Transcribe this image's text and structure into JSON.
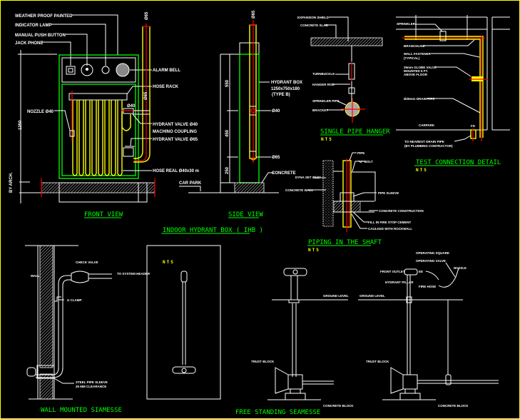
{
  "drawing": {
    "colors": {
      "background": "#000000",
      "border": "#ffff00",
      "titles": "#00ff00",
      "nts": "#ffff00",
      "lines": "#ffffff",
      "pipe": "#ffff00",
      "centerline": "#ff0000",
      "box": "#00ff00"
    },
    "front_view": {
      "title": "FRONT VIEW",
      "labels": {
        "weather_proof": "WEATHER PROOF PAINTED",
        "indicator_lamp": "INDICATOR LAMP",
        "manual_push": "MANUAL PUSH BUTTON",
        "jack_phone": "JACK PHONE",
        "alarm_bell": "ALARM BELL",
        "hose_rack": "HOSE RACK",
        "nozzle": "NOZZLE Ø40",
        "hydrant_valve_40": "HYDRANT VALVE Ø40",
        "machino": "MACHINO COUPLING",
        "hydrant_valve_65": "HYDRANT VALVE Ø65",
        "hose_reel": "HOSE REAL Ø40x30 m",
        "dim_total": "1250",
        "dim_arch": "BY ARCH.",
        "d65_top": "Ø65",
        "d65_side": "Ø65",
        "d40": "Ø40"
      }
    },
    "side_view": {
      "title": "SIDE VIEW",
      "labels": {
        "box": "HYDRANT BOX",
        "box_size": "1250x750x180",
        "box_type": "(TYPE B)",
        "d40": "Ø40",
        "d65": "Ø65",
        "d65_top": "Ø65",
        "concrete": "CONCRETE",
        "car_park": "CAR PARK",
        "dim_top": "550",
        "dim_mid": "450",
        "dim_bot": "250"
      }
    },
    "ihb_title": "INDOOR HYDRANT BOX ( IHB )",
    "single_pipe_hanger": {
      "title": "SINGLE PIPE HANGER",
      "nts": "NTS",
      "labels": {
        "expansion": "EXPANSION SHIELD",
        "slab": "CONCRETE SLAB",
        "turnbuckle": "TURNBUCKLE",
        "hanger_rod": "HANGER ROD",
        "sprinkler_pipe": "SPRINKLER PIPE",
        "bracket": "BRACKET"
      }
    },
    "test_connection": {
      "title": "TEST CONNECTION DETAIL",
      "nts": "NTS",
      "labels": {
        "sprinkler": "SPRINKLER",
        "branchline": "BRANCHLINE",
        "wall_fastener": "WALL FASTENER",
        "typical": "(TYPICAL)",
        "globe1": "25mm GLOBE VALVE",
        "globe2": "MOUNTED 5 FT.",
        "globe3": "ABOVE FLOOR",
        "drain": "Ø25mm DRAIN PIPE",
        "carpark": "CARPARK",
        "fd": "FD",
        "to_drain1": "TO NEAREST DRAIN PIPE",
        "to_drain2": "(BY PLUMBING CONTRACTOR)"
      }
    },
    "piping_shaft": {
      "title": "PIPING IN THE SHAFT",
      "nts": "NTS",
      "labels": {
        "pipe": "PIPE",
        "ubolt": "\"U\" BOLT",
        "dyna": "DYNA SET Ø1/2\"",
        "concrete_wall": "CONCRETE WALL",
        "sleeve": "PIPE SLEEVE",
        "construction": "CONCRETE CONSTRUCTION",
        "firestop": "FILL IN FIRE STOP CEMENT",
        "caulked": "CAULKED WITH ROCKWALL"
      }
    },
    "wall_siamese": {
      "title": "WALL MOUNTED SIAMESSE",
      "nts": "NTS",
      "labels": {
        "wall": "WALL",
        "check": "CHECK VALVE",
        "header": "TO SYSTEM HEADER",
        "uclamp": "U CLAMP",
        "sleeve1": "STEEL PIPE SLEEVE",
        "sleeve2": "25 MM CLEARANCE"
      }
    },
    "free_standing": {
      "title": "FREE STANDING SEAMESSE",
      "labels": {
        "ground": "GROUND LEVEL",
        "thrust": "TRUST BLOCK",
        "concrete": "CONCRETE BLOCK"
      }
    },
    "pillar_hydrant": {
      "labels": {
        "op_square": "OPERATING SQUARE",
        "op_valve": "OPERATING VALVE",
        "nozzle": "NOZZLE",
        "front_outlet": "FRONT OUTLET",
        "ee": "EE",
        "hydrant_pillar": "HYDRANT PILLAR",
        "fire_hose": "FIRE HOSE",
        "ground": "GROUND LEVEL",
        "thrust": "TRUST BLOCK",
        "concrete": "CONCRETE BLOCK"
      }
    }
  }
}
